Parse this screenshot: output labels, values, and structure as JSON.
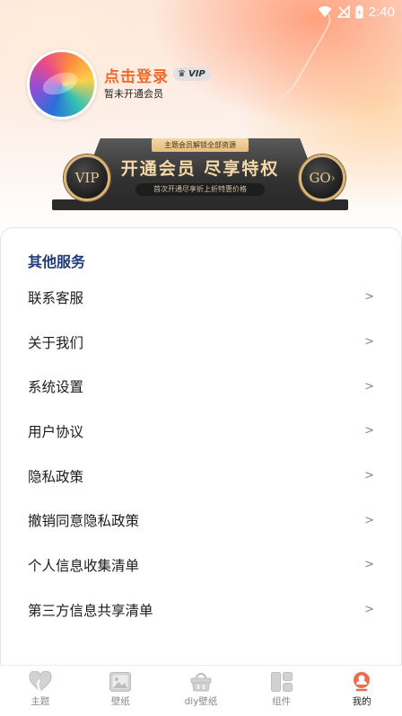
{
  "status_bar": {
    "time": "2:40"
  },
  "profile": {
    "login_title": "点击登录",
    "vip_badge": "VIP",
    "membership_status": "暂未开通会员"
  },
  "vip_banner": {
    "tag": "主题会员解锁全部资源",
    "headline": "开通会员 尽享特权",
    "subline": "首次开通尽享折上折特惠价格",
    "left_coin": "VIP",
    "right_coin": "GO",
    "right_coin_arrow": "›"
  },
  "services": {
    "title": "其他服务",
    "items": [
      {
        "label": "联系客服",
        "arrow": ">"
      },
      {
        "label": "关于我们",
        "arrow": ">"
      },
      {
        "label": "系统设置",
        "arrow": ">"
      },
      {
        "label": "用户协议",
        "arrow": ">"
      },
      {
        "label": "隐私政策",
        "arrow": ">"
      },
      {
        "label": "撤销同意隐私政策",
        "arrow": ">"
      },
      {
        "label": "个人信息收集清单",
        "arrow": ">"
      },
      {
        "label": "第三方信息共享清单",
        "arrow": ">"
      }
    ]
  },
  "tabbar": {
    "active_index": 4,
    "active_color": "#ef6b4a",
    "items": [
      {
        "label": "主题",
        "icon": "heart-icon"
      },
      {
        "label": "壁纸",
        "icon": "picture-icon"
      },
      {
        "label": "diy壁纸",
        "icon": "basket-icon"
      },
      {
        "label": "组件",
        "icon": "widgets-icon"
      },
      {
        "label": "我的",
        "icon": "profile-icon"
      }
    ]
  },
  "colors": {
    "accent": "#ef6b2a",
    "section_title": "#1f3a7a",
    "vip_gold": "#f4d9a8"
  }
}
